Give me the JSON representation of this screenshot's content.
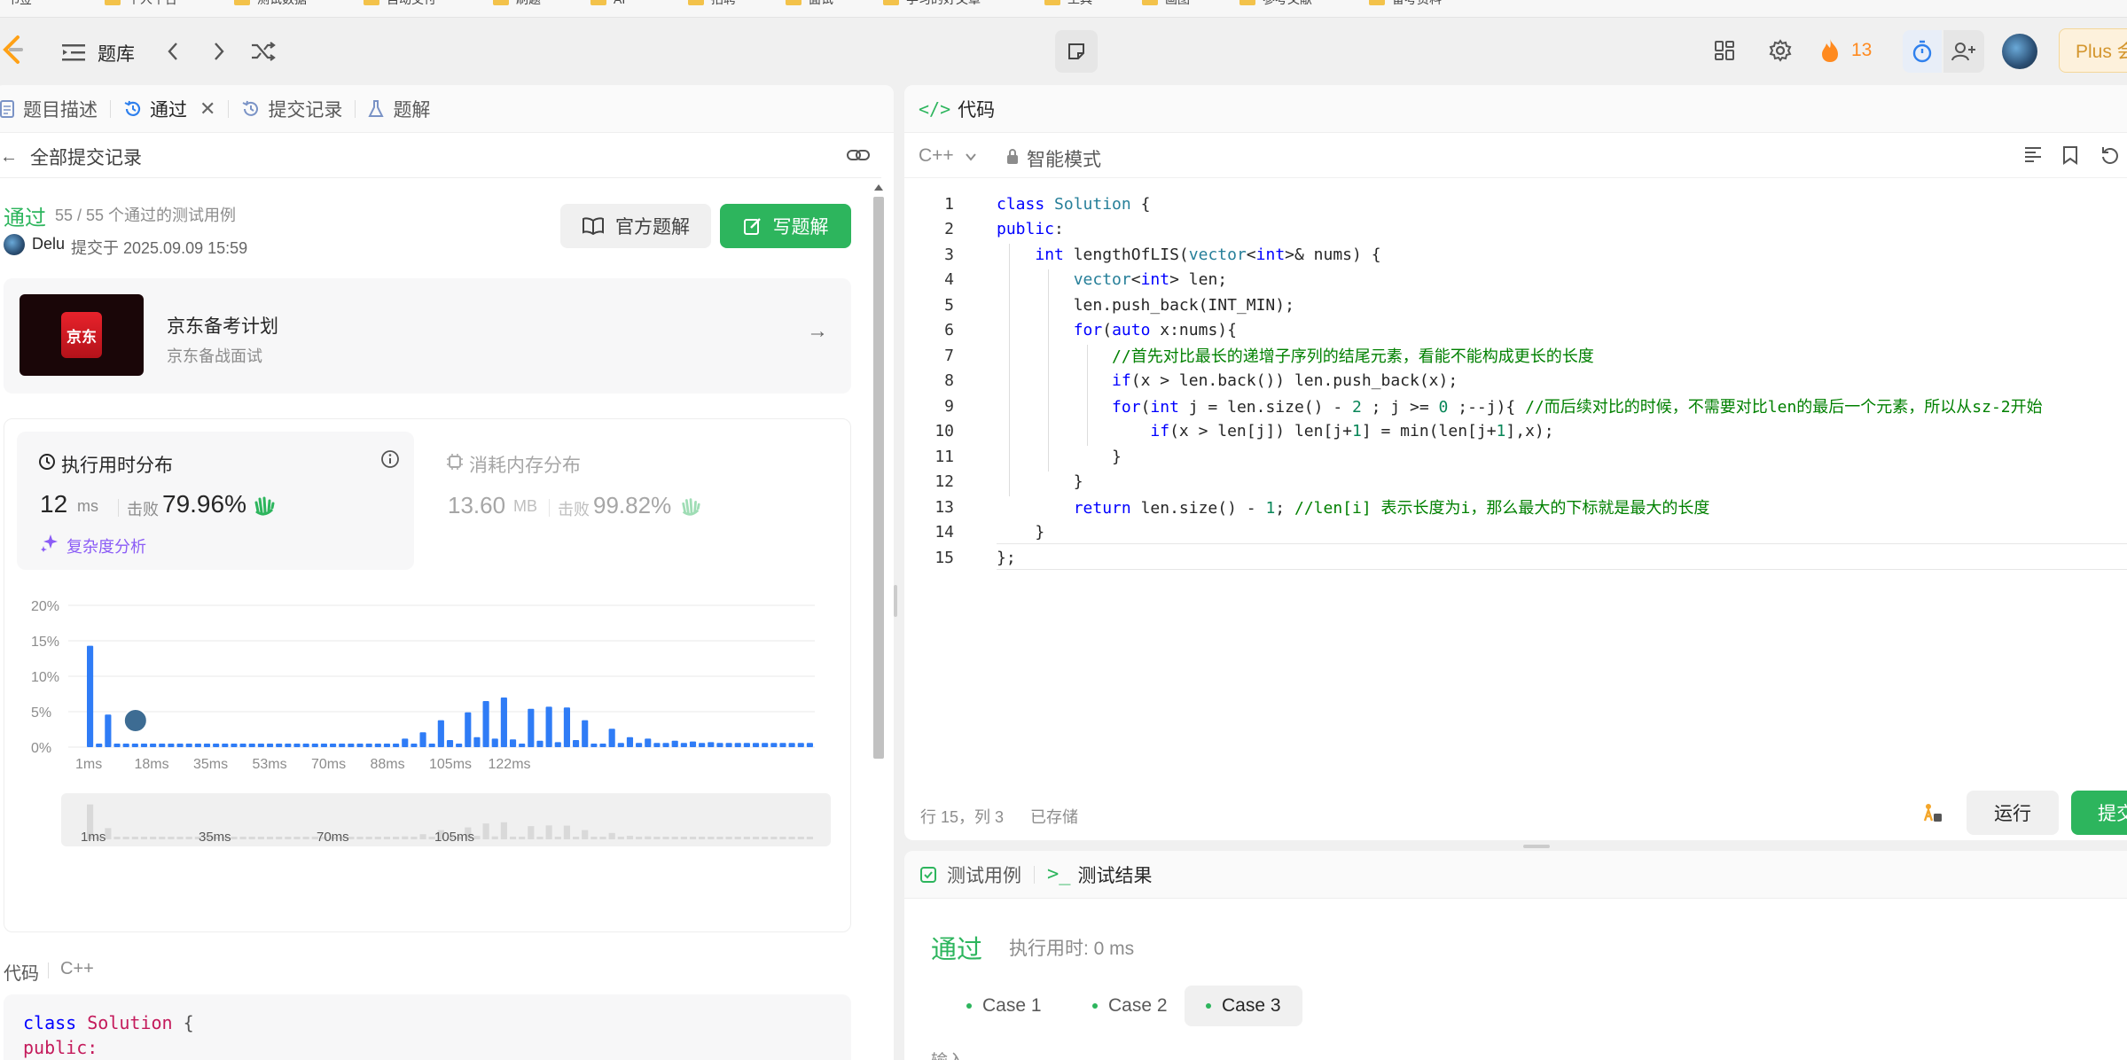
{
  "bookmarks": [
    "书签",
    "个人平台",
    "测试数据",
    "自动交付",
    "刷题",
    "AI",
    "招聘",
    "面试",
    "学习的好文章",
    "工具",
    "画图",
    "参考文献",
    "备考资料"
  ],
  "nav": {
    "logo_icon": "leetcode-logo-icon",
    "problem_list": "题库",
    "streak": "13",
    "plus_label": "Plus 会"
  },
  "left_tabs": {
    "description": "题目描述",
    "accepted": "通过",
    "submissions": "提交记录",
    "solutions": "题解"
  },
  "submission": {
    "back_label": "全部提交记录",
    "status": "通过",
    "passed_cases": "55 / 55 个通过的测试用例",
    "user": "Delu",
    "submitted_at": "提交于 2025.09.09 15:59",
    "official_solution_btn": "官方题解",
    "write_solution_btn": "写题解"
  },
  "promo": {
    "logo_text": "京东",
    "title": "京东备考计划",
    "subtitle": "京东备战面试"
  },
  "stats": {
    "runtime_title": "执行用时分布",
    "runtime_value": "12",
    "runtime_unit": "ms",
    "beats_label": "击败",
    "runtime_beats": "79.96%",
    "complexity_link": "复杂度分析",
    "memory_title": "消耗内存分布",
    "memory_value": "13.60",
    "memory_unit": "MB",
    "memory_beats": "99.82%"
  },
  "chart_data": {
    "type": "bar",
    "yticks": [
      "20%",
      "15%",
      "10%",
      "5%",
      "0%"
    ],
    "ylim": [
      0,
      20
    ],
    "xticks": [
      "1ms",
      "18ms",
      "35ms",
      "53ms",
      "70ms",
      "88ms",
      "105ms",
      "122ms"
    ],
    "values": [
      14.3,
      0.5,
      4.6,
      0.5,
      0.5,
      0.5,
      0.5,
      0.5,
      0.5,
      0.5,
      0.5,
      0.5,
      0.5,
      0.5,
      0.5,
      0.5,
      0.5,
      0.5,
      0.5,
      0.5,
      0.5,
      0.5,
      0.5,
      0.5,
      0.5,
      0.5,
      0.5,
      0.5,
      0.5,
      0.5,
      0.5,
      0.5,
      0.5,
      0.5,
      0.5,
      1.2,
      0.5,
      2.1,
      0.5,
      3.8,
      1.0,
      0.5,
      4.9,
      1.4,
      6.5,
      1.2,
      7.0,
      1.1,
      0.5,
      5.4,
      0.9,
      5.7,
      0.7,
      5.6,
      1.0,
      3.8,
      0.5,
      0.5,
      2.6,
      0.6,
      1.4,
      0.6,
      1.2,
      0.6,
      0.6,
      0.9,
      0.6,
      0.8,
      0.6,
      0.7,
      0.6,
      0.6,
      0.6,
      0.6,
      0.6,
      0.6,
      0.6,
      0.6,
      0.6,
      0.6,
      0.6
    ],
    "highlight_index": 5,
    "overview_xticks": [
      "1ms",
      "35ms",
      "70ms",
      "105ms"
    ]
  },
  "code_preview": {
    "label": "代码",
    "lang": "C++",
    "lines": [
      "class Solution {",
      "public:"
    ]
  },
  "editor": {
    "title": "代码",
    "lang": "C++",
    "mode": "智能模式",
    "lines": [
      "class Solution {",
      "public:",
      "    int lengthOfLIS(vector<int>& nums) {",
      "        vector<int> len;",
      "        len.push_back(INT_MIN);",
      "        for(auto x:nums){",
      "            //首先对比最长的递增子序列的结尾元素，看能不能构成更长的长度",
      "            if(x > len.back()) len.push_back(x);",
      "            for(int j = len.size() - 2 ; j >= 0 ;--j){ //而后续对比的时候，不需要对比len的最后一个元素，所以从sz-2开始",
      "                if(x > len[j]) len[j+1] = min(len[j+1],x);",
      "            }",
      "        }",
      "        return len.size() - 1; //len[i] 表示长度为i，那么最大的下标就是最大的长度",
      "    }",
      "};"
    ],
    "cursor": "行 15，列 3",
    "saved": "已存储",
    "run_btn": "运行",
    "submit_btn": "提交"
  },
  "result": {
    "tab_testcase": "测试用例",
    "tab_result": "测试结果",
    "status": "通过",
    "runtime": "执行用时: 0 ms",
    "cases": [
      "Case 1",
      "Case 2",
      "Case 3"
    ],
    "input_label": "输入"
  }
}
